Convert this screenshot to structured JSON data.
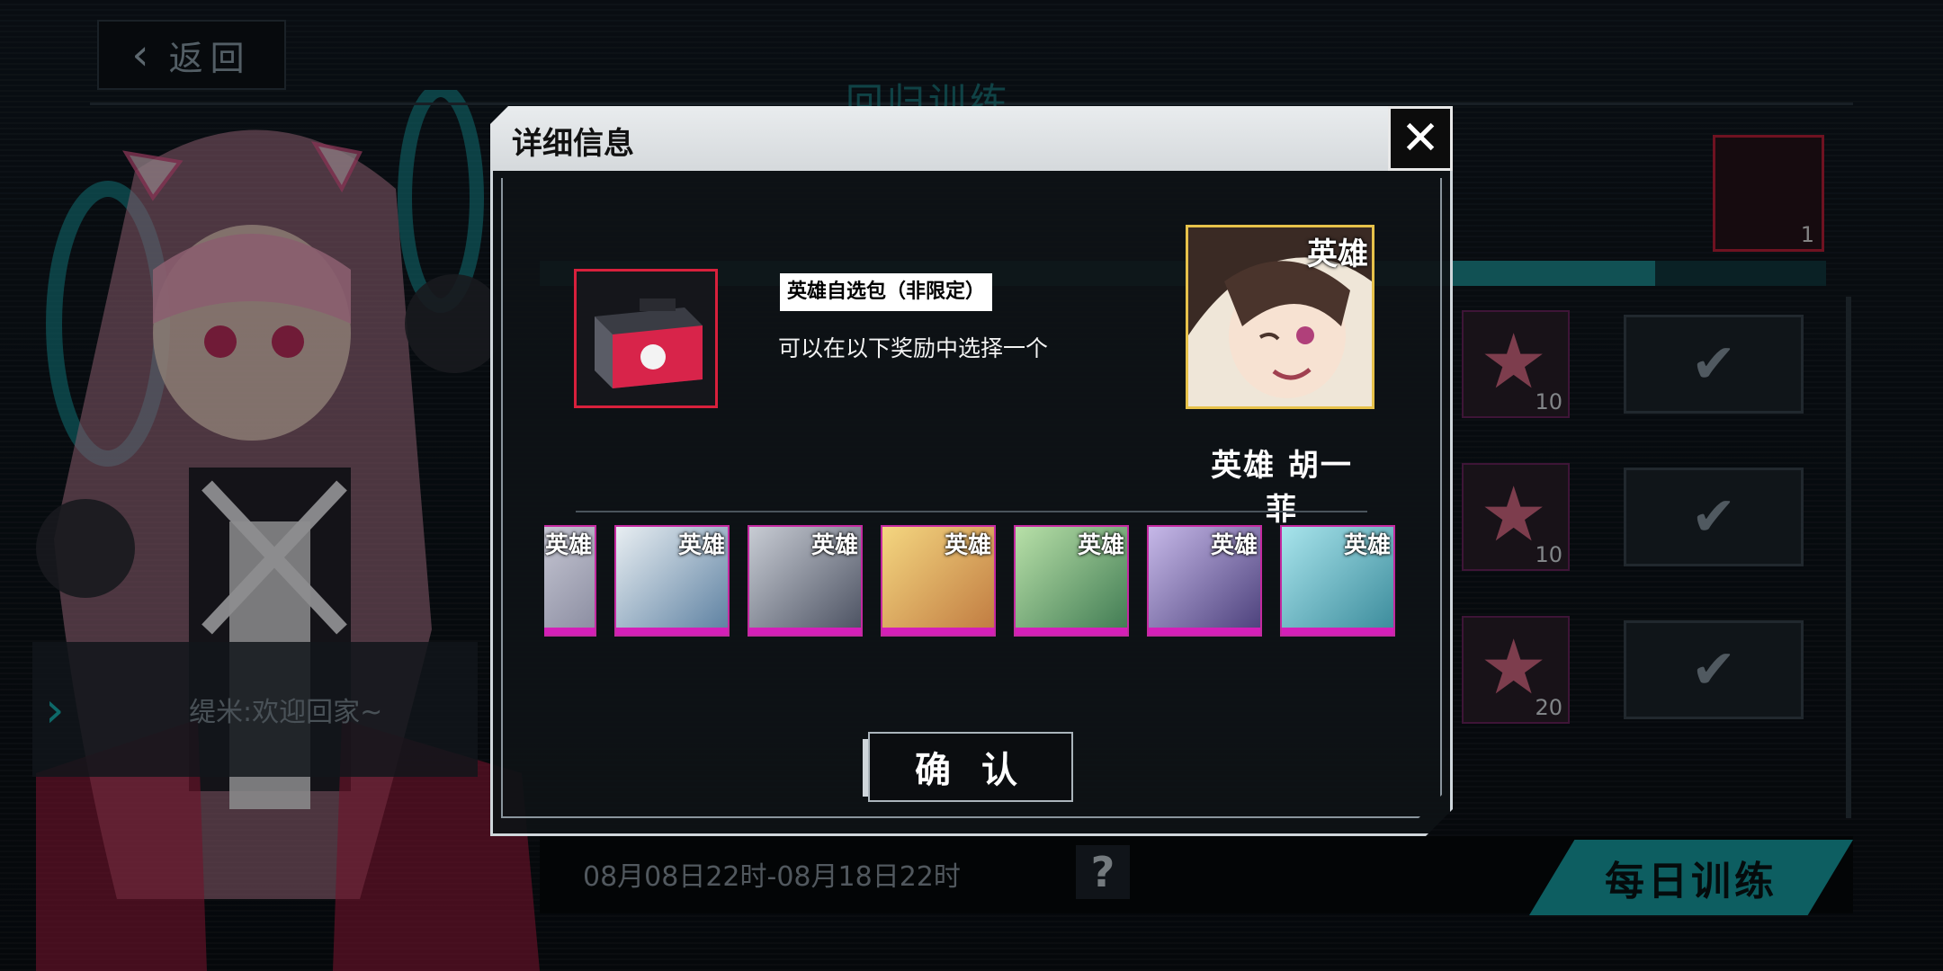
{
  "header": {
    "back_label": "返回",
    "title": "回归训练"
  },
  "welcome": {
    "text": "缇米:欢迎回家~"
  },
  "event": {
    "date_range": "08月08日22时-08月18日22时",
    "daily_tab": "每日训练"
  },
  "background_rewards": [
    {
      "count": "10"
    },
    {
      "count": "10"
    },
    {
      "count": "20"
    }
  ],
  "top_reward": {
    "count": "1"
  },
  "dialog": {
    "title": "详细信息",
    "item_name": "英雄自选包（非限定）",
    "item_desc": "可以在以下奖励中选择一个",
    "selected": {
      "badge": "英雄",
      "name": "英雄 胡一菲"
    },
    "heroes": [
      {
        "badge": "英雄"
      },
      {
        "badge": "英雄"
      },
      {
        "badge": "英雄"
      },
      {
        "badge": "英雄"
      },
      {
        "badge": "英雄"
      },
      {
        "badge": "英雄"
      },
      {
        "badge": "英雄"
      }
    ],
    "confirm_label": "确 认"
  },
  "colors": {
    "accent": "#17a3a8",
    "rarity": "#d41fb8",
    "item_border": "#d8203c"
  }
}
